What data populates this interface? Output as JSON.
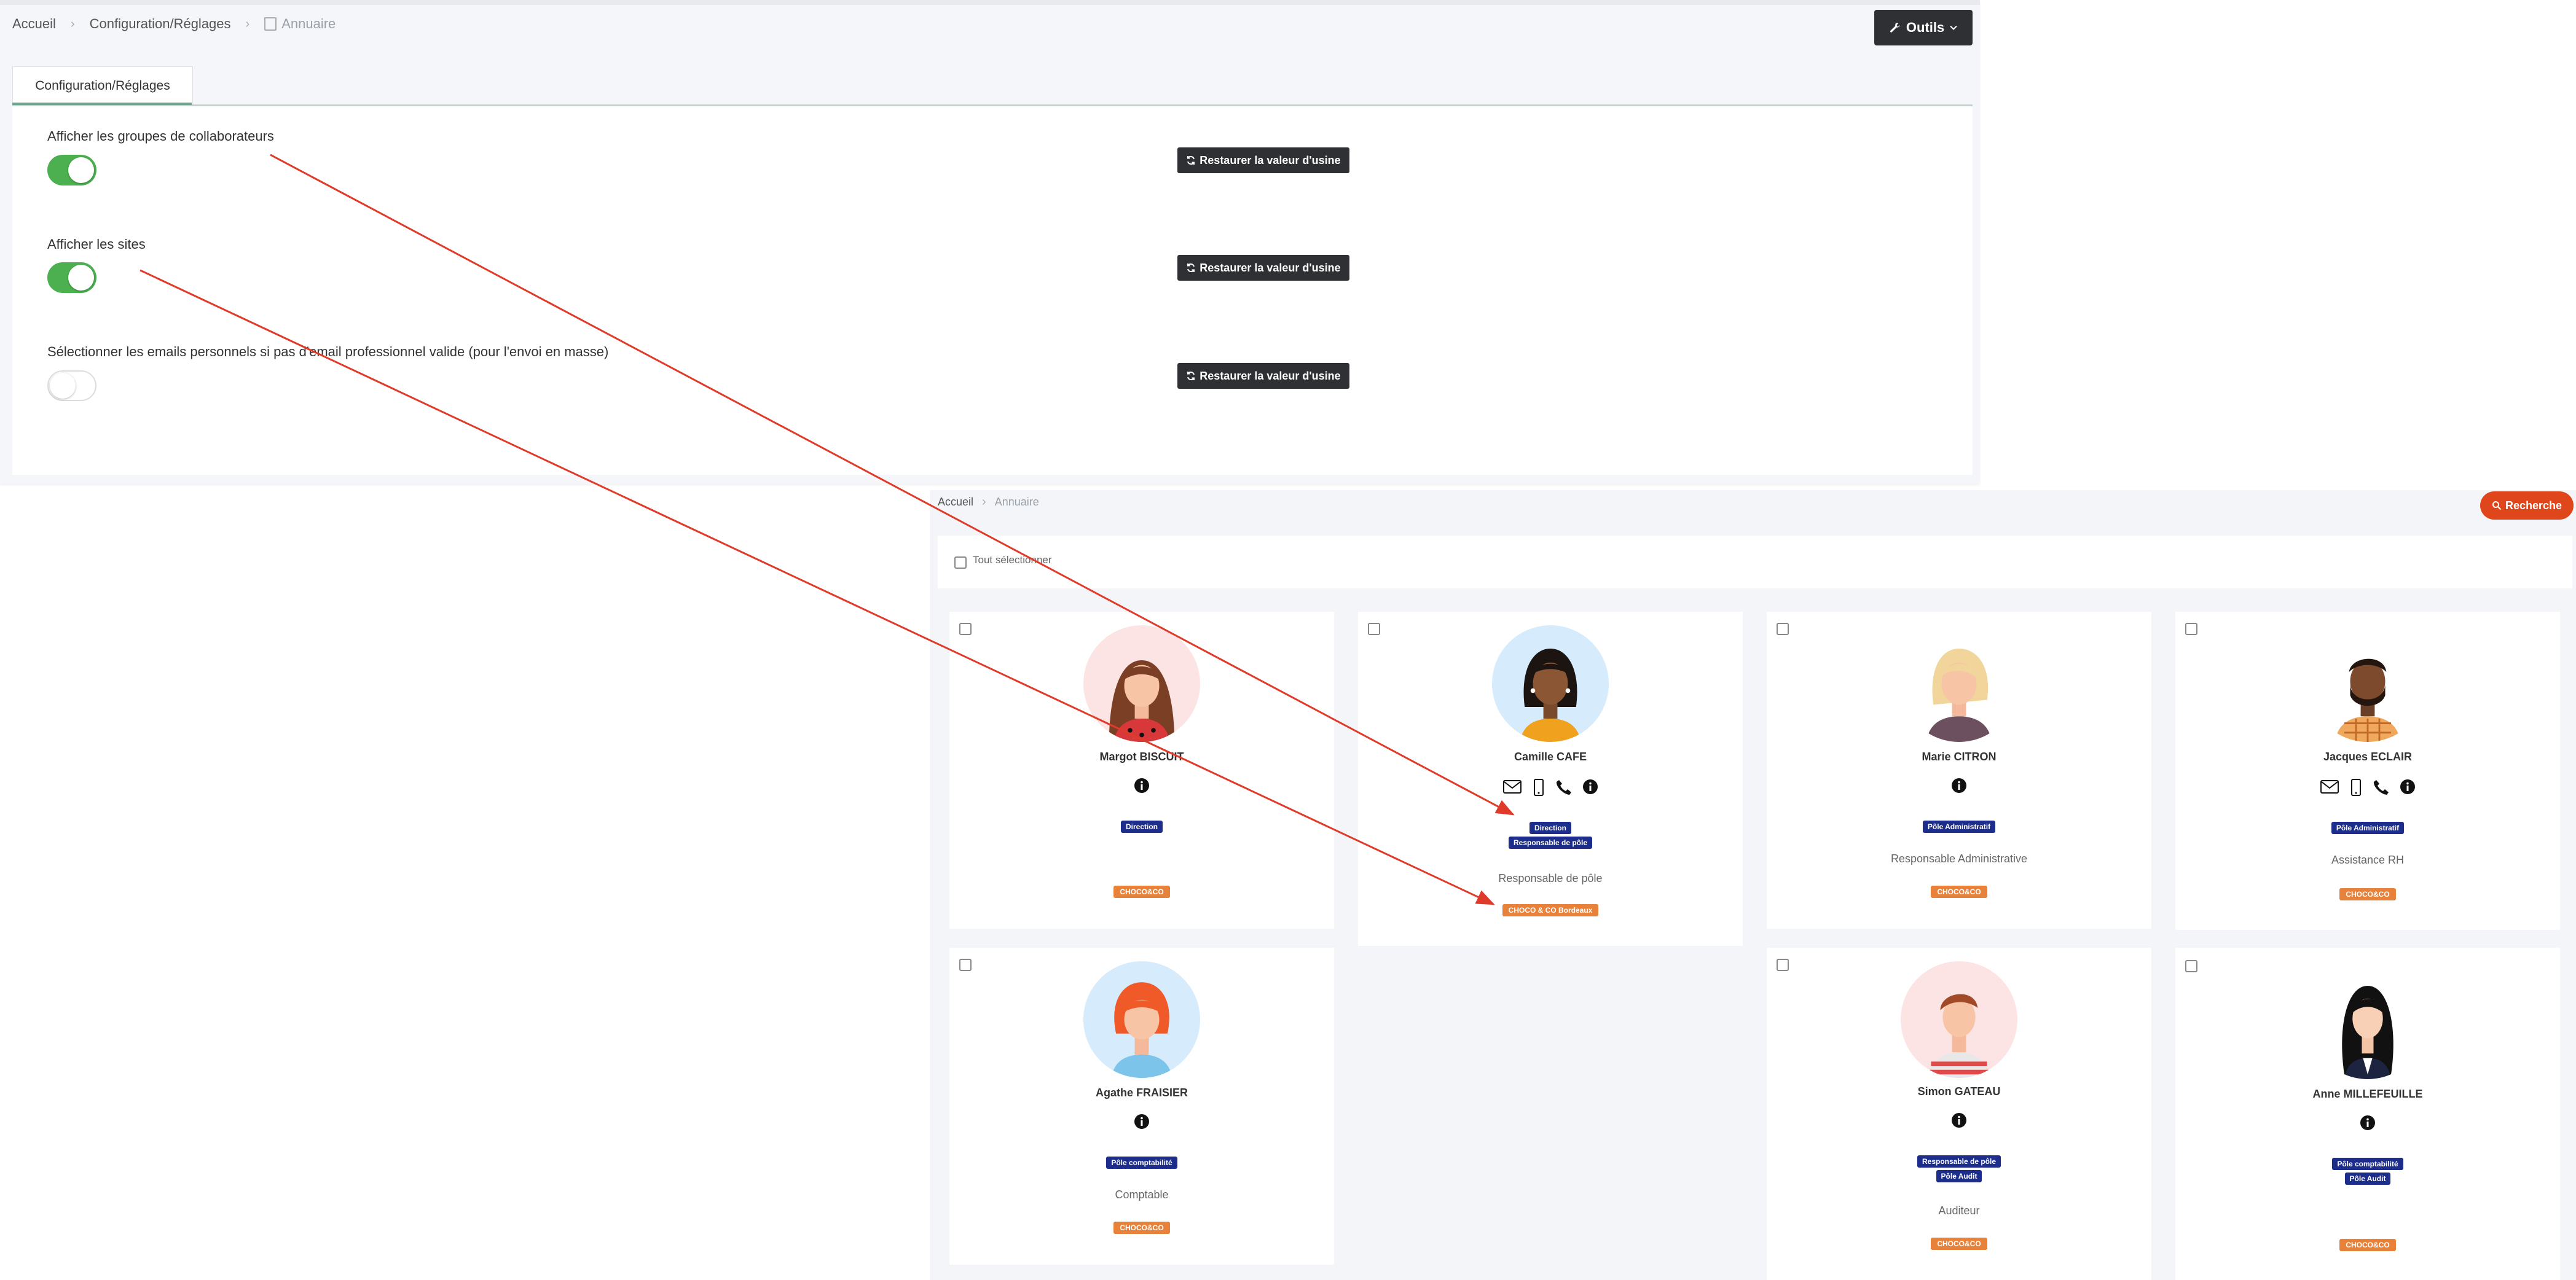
{
  "settings": {
    "breadcrumb": {
      "home": "Accueil",
      "config": "Configuration/Réglages",
      "current": "Annuaire"
    },
    "tools_label": "Outils",
    "tab_label": "Configuration/Réglages",
    "restore_label": "Restaurer la valeur d'usine",
    "options": [
      {
        "label": "Afficher les groupes de collaborateurs",
        "enabled": true
      },
      {
        "label": "Afficher les sites",
        "enabled": true
      },
      {
        "label": "Sélectionner les emails personnels si pas d'email professionnel valide (pour l'envoi en masse)",
        "enabled": false
      }
    ]
  },
  "directory": {
    "breadcrumb": {
      "home": "Accueil",
      "current": "Annuaire"
    },
    "search_label": "Recherche",
    "select_all_label": "Tout sélectionner",
    "people": [
      {
        "name": "Margot BISCUIT",
        "groups": [
          "Direction"
        ],
        "job": "",
        "site": "CHOCO&CO"
      },
      {
        "name": "Camille CAFE",
        "groups": [
          "Direction",
          "Responsable de pôle"
        ],
        "job": "Responsable de pôle",
        "site": "CHOCO & CO Bordeaux"
      },
      {
        "name": "Marie CITRON",
        "groups": [
          "Pôle Administratif"
        ],
        "job": "Responsable Administrative",
        "site": "CHOCO&CO"
      },
      {
        "name": "Jacques ECLAIR",
        "groups": [
          "Pôle Administratif"
        ],
        "job": "Assistance RH",
        "site": "CHOCO&CO"
      },
      {
        "name": "Agathe FRAISIER",
        "groups": [
          "Pôle comptabilité"
        ],
        "job": "Comptable",
        "site": "CHOCO&CO"
      },
      {
        "name": "Simon GATEAU",
        "groups": [
          "Responsable de pôle",
          "Pôle Audit"
        ],
        "job": "Auditeur",
        "site": "CHOCO&CO"
      },
      {
        "name": "Anne MILLEFEUILLE",
        "groups": [
          "Pôle comptabilité",
          "Pôle Audit"
        ],
        "job": "",
        "site": "CHOCO&CO"
      }
    ]
  },
  "colors": {
    "toggle_on": "#4cb050",
    "dark_button": "#2f3033",
    "search_button": "#e0461c",
    "group_badge": "#1d2d8c",
    "site_badge": "#e8823a",
    "annotation_arrow": "#e03a2a"
  }
}
